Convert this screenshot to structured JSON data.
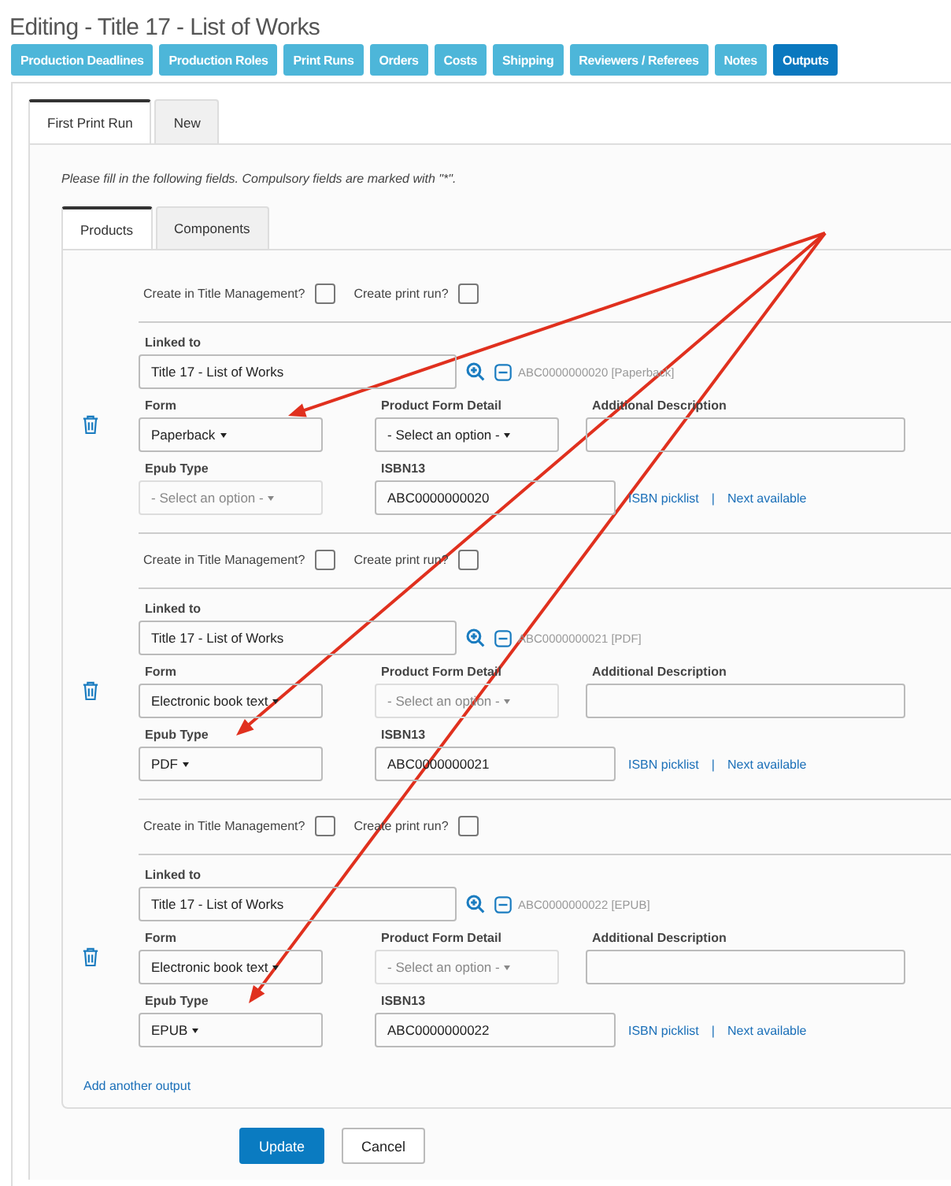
{
  "title": "Editing - Title 17 - List of Works",
  "nav_tabs": [
    {
      "label": "Production Deadlines",
      "selected": false
    },
    {
      "label": "Production Roles",
      "selected": false
    },
    {
      "label": "Print Runs",
      "selected": false
    },
    {
      "label": "Orders",
      "selected": false
    },
    {
      "label": "Costs",
      "selected": false
    },
    {
      "label": "Shipping",
      "selected": false
    },
    {
      "label": "Reviewers / Referees",
      "selected": false
    },
    {
      "label": "Notes",
      "selected": false
    },
    {
      "label": "Outputs",
      "selected": true
    }
  ],
  "print_run_tabs": [
    {
      "label": "First Print Run",
      "selected": true
    },
    {
      "label": "New",
      "selected": false
    }
  ],
  "instructions": "Please fill in the following fields. Compulsory fields are marked with \"*\".",
  "product_tabs": [
    {
      "label": "Products",
      "selected": true
    },
    {
      "label": "Components",
      "selected": false
    }
  ],
  "outputs": [
    {
      "create_title_label": "Create in Title Management?",
      "create_title_checked": false,
      "create_print_label": "Create print run?",
      "create_print_checked": false,
      "linked_label": "Linked to",
      "linked_value": "Title 17 - List of Works",
      "linked_code": "ABC0000000020 [Paperback]",
      "form_label": "Form",
      "form_value": "Paperback",
      "form_disabled": false,
      "detail_label": "Product Form Detail",
      "detail_value": "- Select an option -",
      "detail_disabled": false,
      "desc_label": "Additional Description",
      "epub_label": "Epub Type",
      "epub_value": "- Select an option -",
      "epub_disabled": true,
      "isbn_label": "ISBN13",
      "isbn_value": "ABC0000000020",
      "picklist_link": "ISBN picklist",
      "separator": "|",
      "next_link": "Next available"
    },
    {
      "create_title_label": "Create in Title Management?",
      "create_title_checked": false,
      "create_print_label": "Create print run?",
      "create_print_checked": false,
      "linked_label": "Linked to",
      "linked_value": "Title 17 - List of Works",
      "linked_code": "ABC0000000021 [PDF]",
      "form_label": "Form",
      "form_value": "Electronic book text",
      "form_disabled": false,
      "detail_label": "Product Form Detail",
      "detail_value": "- Select an option -",
      "detail_disabled": true,
      "desc_label": "Additional Description",
      "epub_label": "Epub Type",
      "epub_value": "PDF",
      "epub_disabled": false,
      "isbn_label": "ISBN13",
      "isbn_value": "ABC0000000021",
      "picklist_link": "ISBN picklist",
      "separator": "|",
      "next_link": "Next available"
    },
    {
      "create_title_label": "Create in Title Management?",
      "create_title_checked": false,
      "create_print_label": "Create print run?",
      "create_print_checked": false,
      "linked_label": "Linked to",
      "linked_value": "Title 17 - List of Works",
      "linked_code": "ABC0000000022 [EPUB]",
      "form_label": "Form",
      "form_value": "Electronic book text",
      "form_disabled": false,
      "detail_label": "Product Form Detail",
      "detail_value": "- Select an option -",
      "detail_disabled": true,
      "desc_label": "Additional Description",
      "epub_label": "Epub Type",
      "epub_value": "EPUB",
      "epub_disabled": false,
      "isbn_label": "ISBN13",
      "isbn_value": "ABC0000000022",
      "picklist_link": "ISBN picklist",
      "separator": "|",
      "next_link": "Next available"
    }
  ],
  "add_link": "Add another output",
  "buttons": [
    {
      "label": "Update",
      "kind": "primary"
    },
    {
      "label": "Cancel",
      "kind": "default"
    }
  ]
}
